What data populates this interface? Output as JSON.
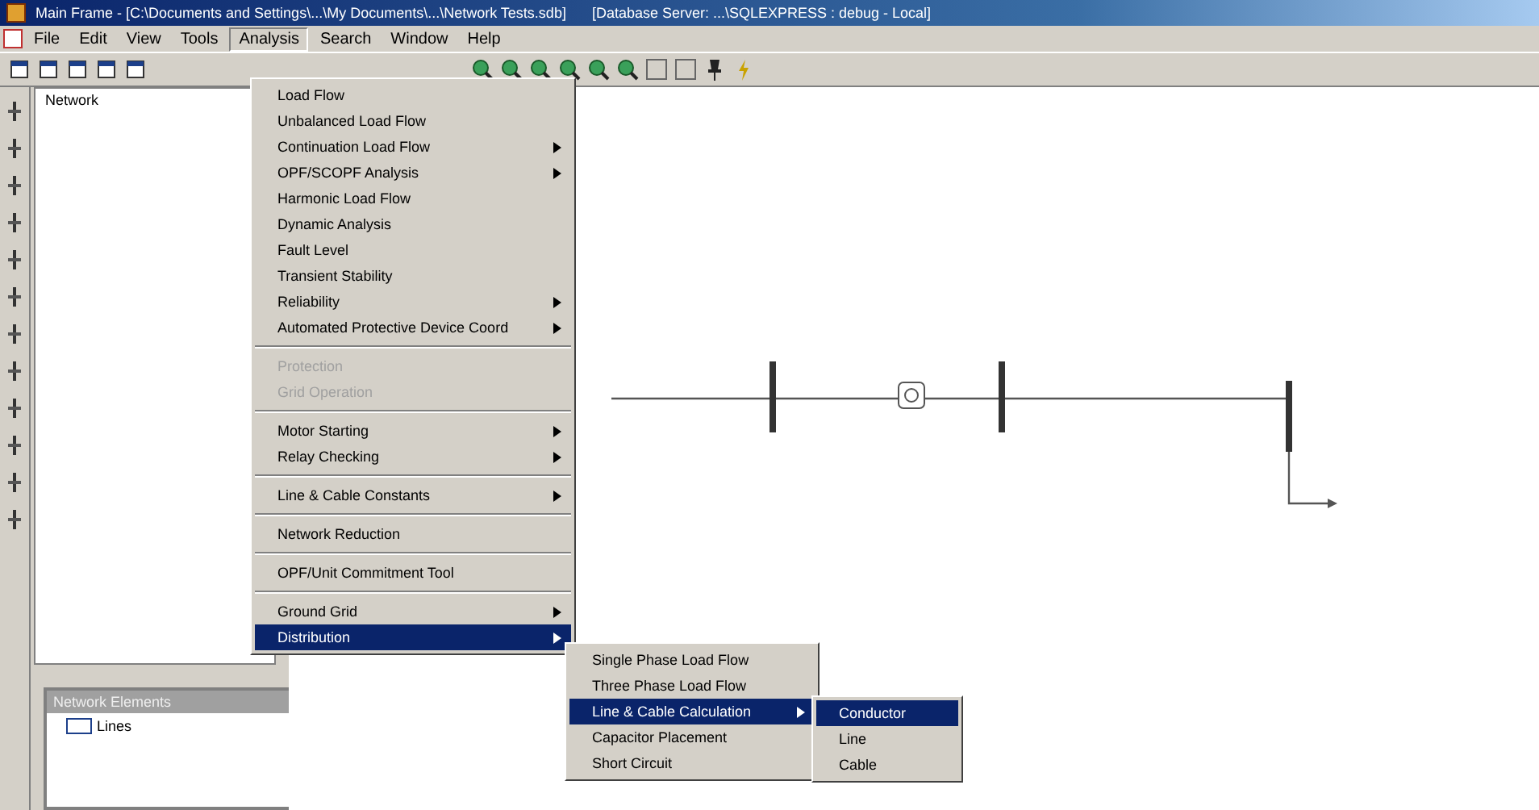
{
  "window": {
    "title": "Main Frame - [C:\\Documents and Settings\\...\\My Documents\\...\\Network Tests.sdb]",
    "title_extra": "[Database Server: ...\\SQLEXPRESS : debug - Local]"
  },
  "menu_bar": [
    {
      "label": "File",
      "selected": false
    },
    {
      "label": "Edit",
      "selected": false
    },
    {
      "label": "View",
      "selected": false
    },
    {
      "label": "Tools",
      "selected": false
    },
    {
      "label": "Analysis",
      "selected": true
    },
    {
      "label": "Search",
      "selected": false
    },
    {
      "label": "Window",
      "selected": false
    },
    {
      "label": "Help",
      "selected": false
    }
  ],
  "tree": {
    "root": "Network"
  },
  "bottom_panel": {
    "title": "Network Elements",
    "items": [
      "Lines"
    ]
  },
  "analysis_menu": {
    "groups": [
      [
        {
          "label": "Load Flow",
          "submenu": false,
          "disabled": false,
          "selected": false
        },
        {
          "label": "Unbalanced Load Flow",
          "submenu": false,
          "disabled": false,
          "selected": false
        },
        {
          "label": "Continuation Load Flow",
          "submenu": true,
          "disabled": false,
          "selected": false
        },
        {
          "label": "OPF/SCOPF Analysis",
          "submenu": true,
          "disabled": false,
          "selected": false
        },
        {
          "label": "Harmonic Load Flow",
          "submenu": false,
          "disabled": false,
          "selected": false
        },
        {
          "label": "Dynamic Analysis",
          "submenu": false,
          "disabled": false,
          "selected": false
        },
        {
          "label": "Fault Level",
          "submenu": false,
          "disabled": false,
          "selected": false
        },
        {
          "label": "Transient Stability",
          "submenu": false,
          "disabled": false,
          "selected": false
        },
        {
          "label": "Reliability",
          "submenu": true,
          "disabled": false,
          "selected": false
        },
        {
          "label": "Automated Protective Device Coord",
          "submenu": true,
          "disabled": false,
          "selected": false
        }
      ],
      [
        {
          "label": "Protection",
          "submenu": false,
          "disabled": true,
          "selected": false
        },
        {
          "label": "Grid Operation",
          "submenu": false,
          "disabled": true,
          "selected": false
        }
      ],
      [
        {
          "label": "Motor Starting",
          "submenu": true,
          "disabled": false,
          "selected": false
        },
        {
          "label": "Relay Checking",
          "submenu": true,
          "disabled": false,
          "selected": false
        }
      ],
      [
        {
          "label": "Line & Cable Constants",
          "submenu": true,
          "disabled": false,
          "selected": false
        }
      ],
      [
        {
          "label": "Network Reduction",
          "submenu": false,
          "disabled": false,
          "selected": false
        }
      ],
      [
        {
          "label": "OPF/Unit Commitment Tool",
          "submenu": false,
          "disabled": false,
          "selected": false
        }
      ],
      [
        {
          "label": "Ground Grid",
          "submenu": true,
          "disabled": false,
          "selected": false
        },
        {
          "label": "Distribution",
          "submenu": true,
          "disabled": false,
          "selected": true
        }
      ]
    ]
  },
  "distribution_menu": [
    {
      "label": "Single Phase Load Flow",
      "submenu": false,
      "selected": false
    },
    {
      "label": "Three Phase Load Flow",
      "submenu": false,
      "selected": false
    },
    {
      "label": "Line & Cable Calculation",
      "submenu": true,
      "selected": true
    },
    {
      "label": "Capacitor Placement",
      "submenu": false,
      "selected": false
    },
    {
      "label": "Short Circuit",
      "submenu": false,
      "selected": false
    }
  ],
  "calculation_menu": [
    {
      "label": "Conductor",
      "selected": true
    },
    {
      "label": "Line",
      "selected": false
    },
    {
      "label": "Cable",
      "selected": false
    }
  ]
}
